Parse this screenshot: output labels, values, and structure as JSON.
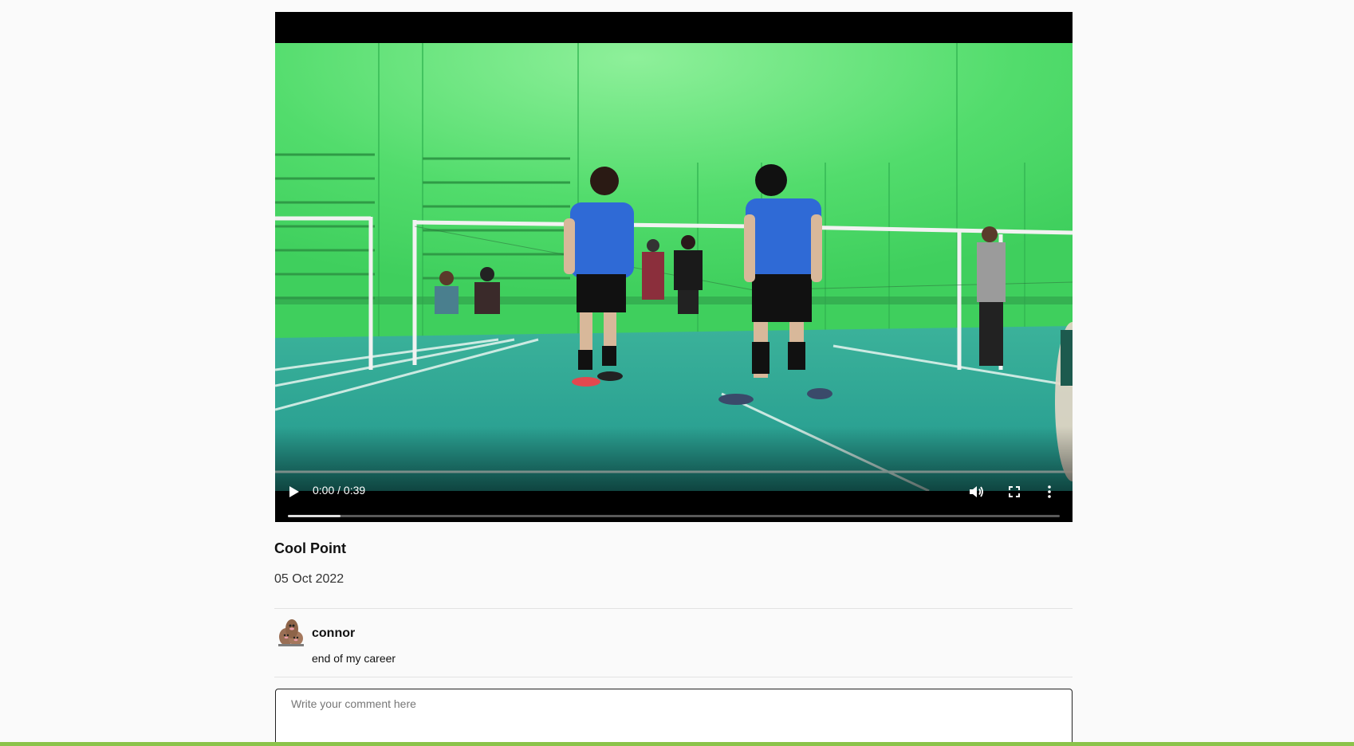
{
  "video": {
    "time_display": "0:00 / 0:39",
    "progress": 0,
    "buffered_fraction": 0.068,
    "court_color": "#2aa59a",
    "wall_color": "#4bd86b"
  },
  "post": {
    "title": "Cool Point",
    "date": "05 Oct 2022"
  },
  "comments": [
    {
      "author": "connor",
      "text": "end of my career",
      "avatar": "avatar-icon"
    }
  ],
  "comment_input": {
    "placeholder": "Write your comment here",
    "value": ""
  },
  "colors": {
    "accent_bar": "#8bc34a",
    "page_background": "#fafafa"
  }
}
